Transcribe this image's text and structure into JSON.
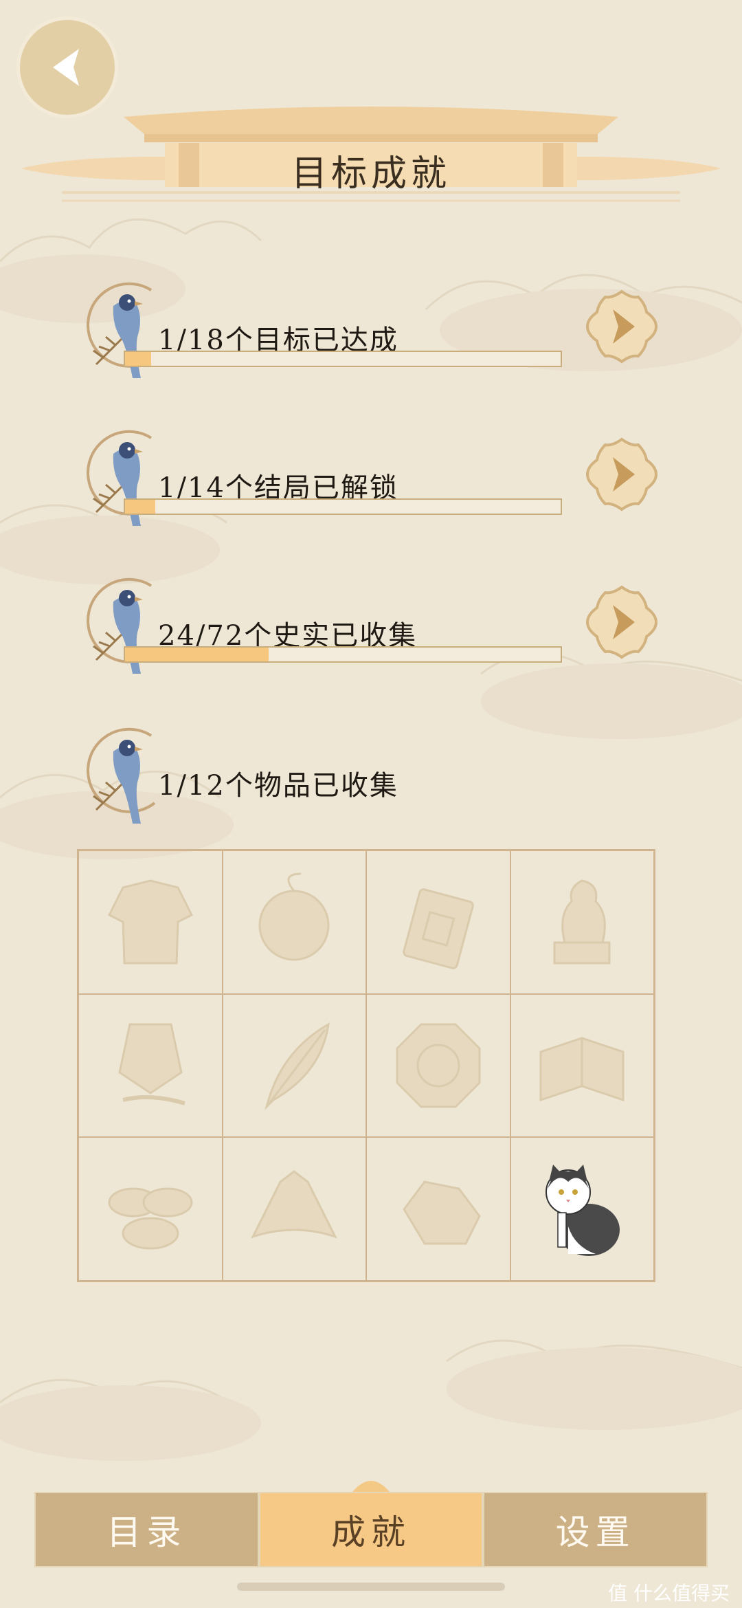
{
  "header": {
    "title": "目标成就"
  },
  "achievements": [
    {
      "label": "1/18个目标已达成",
      "progress": 0.06,
      "has_arrow": true
    },
    {
      "label": "1/14个结局已解锁",
      "progress": 0.07,
      "has_arrow": true
    },
    {
      "label": "24/72个史实已收集",
      "progress": 0.33,
      "has_arrow": true
    },
    {
      "label": "1/12个物品已收集",
      "progress": null,
      "has_arrow": false
    }
  ],
  "items": [
    {
      "icon": "robe-icon",
      "collected": false
    },
    {
      "icon": "fan-icon",
      "collected": false
    },
    {
      "icon": "token-pendant-icon",
      "collected": false
    },
    {
      "icon": "lion-statue-icon",
      "collected": false
    },
    {
      "icon": "lantern-icon",
      "collected": false
    },
    {
      "icon": "feather-icon",
      "collected": false
    },
    {
      "icon": "octagon-mirror-icon",
      "collected": false
    },
    {
      "icon": "book-icon",
      "collected": false
    },
    {
      "icon": "gold-ingots-icon",
      "collected": false
    },
    {
      "icon": "hat-icon",
      "collected": false
    },
    {
      "icon": "rock-icon",
      "collected": false
    },
    {
      "icon": "cat-icon",
      "collected": true
    }
  ],
  "tabs": [
    {
      "label": "目录",
      "active": false
    },
    {
      "label": "成就",
      "active": true
    },
    {
      "label": "设置",
      "active": false
    }
  ],
  "watermark": "值 什么值得买",
  "colors": {
    "accent": "#f7c986",
    "tab": "#cdb186",
    "background": "#efe7d6",
    "progress_fill": "#f6c77e"
  }
}
